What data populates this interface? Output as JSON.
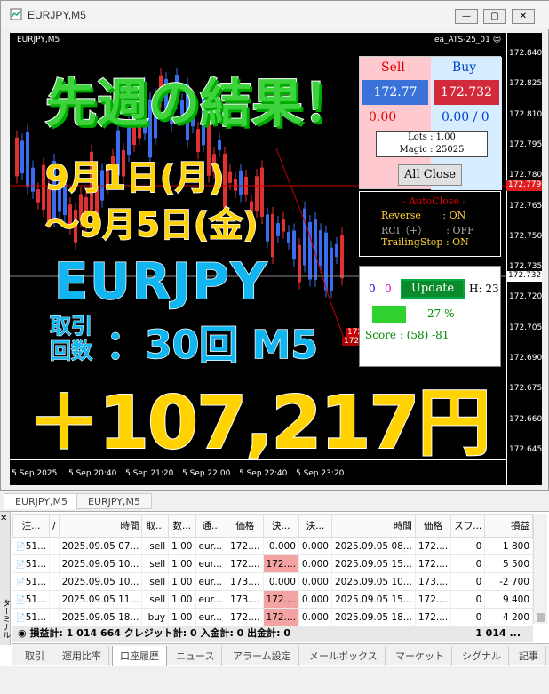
{
  "window": {
    "title": "EURJPY,M5",
    "btn_min": "—",
    "btn_max": "▢",
    "btn_close": "✕"
  },
  "chart": {
    "symbol_label": "EURJPY,M5",
    "ea_label": "ea_ATS-25_01 ☺",
    "price_ticks": [
      "172.840",
      "172.825",
      "172.810",
      "172.795",
      "172.780",
      "172.765",
      "172.750",
      "172.735",
      "172.720",
      "172.705",
      "172.690",
      "172.675",
      "172.660",
      "172.645"
    ],
    "current_price": "172.732",
    "sell_line_price": "172.779",
    "time_ticks": [
      "5 Sep 2025",
      "5 Sep 20:40",
      "5 Sep 21:20",
      "5 Sep 22:00",
      "5 Sep 22:40",
      "5 Sep 23:20"
    ],
    "tags": [
      "172.705",
      "172.703"
    ]
  },
  "overlay": {
    "headline": "先週の結果！",
    "date_from": "9月1日(月)",
    "date_to": "〜9月5日(金)",
    "pair": "EURJPY",
    "trades_label": "取引\n回数",
    "trades_value": "：30回 M5",
    "profit": "＋107,217円"
  },
  "panel": {
    "sell_label": "Sell",
    "buy_label": "Buy",
    "sell_price": "172.77",
    "buy_price": "172.732",
    "sell_pl": "0.00",
    "buy_pl": "0.00 / 0",
    "lots": "Lots   : 1.00",
    "magic": "Magic : 25025",
    "all_close": "All Close",
    "auto_close_title": "- AutoClose -",
    "reverse": "Reverse       : ON",
    "rci": "RCI（+）      : OFF",
    "trailing": "TrailingStop : ON",
    "counter_a": "0",
    "counter_b": "0",
    "update": "Update",
    "h_value": "H: 23",
    "percent": "27 %",
    "score": "Score : (58) -81"
  },
  "chart_tabs": [
    "EURJPY,M5",
    "EURJPY,M5"
  ],
  "table": {
    "headers": [
      "注...",
      "/",
      "時間",
      "取...",
      "数...",
      "通...",
      "価格",
      "決...",
      "決...",
      "時間",
      "価格",
      "スワ...",
      "損益"
    ],
    "rows": [
      [
        "51...",
        "2025.09.05 07...",
        "sell",
        "1.00",
        "eur...",
        "172....",
        "0.000",
        "0.000",
        "2025.09.05 08...",
        "172....",
        "0",
        "1 800"
      ],
      [
        "51...",
        "2025.09.05 10...",
        "sell",
        "1.00",
        "eur...",
        "172....",
        "172....",
        "0.000",
        "2025.09.05 15...",
        "172....",
        "0",
        "5 500"
      ],
      [
        "51...",
        "2025.09.05 10...",
        "sell",
        "1.00",
        "eur...",
        "173....",
        "0.000",
        "0.000",
        "2025.09.05 10...",
        "173....",
        "0",
        "-2 700"
      ],
      [
        "51...",
        "2025.09.05 11...",
        "sell",
        "1.00",
        "eur...",
        "173....",
        "172....",
        "0.000",
        "2025.09.05 15...",
        "172....",
        "0",
        "9 400"
      ],
      [
        "51...",
        "2025.09.05 18...",
        "buy",
        "1.00",
        "eur...",
        "172....",
        "172....",
        "0.000",
        "2025.09.05 18...",
        "172....",
        "0",
        "4 200"
      ]
    ],
    "summary": "損益計: 1 014 664  クレジット計: 0  入金計: 0  出金計: 0",
    "summary_total": "1 014 ..."
  },
  "bottom_tabs": [
    "取引",
    "運用比率",
    "口座履歴",
    "ニュース",
    "アラーム設定",
    "メールボックス",
    "マーケット",
    "シグナル",
    "記事",
    "ライブ"
  ],
  "sidebar_label": "ターミナル"
}
